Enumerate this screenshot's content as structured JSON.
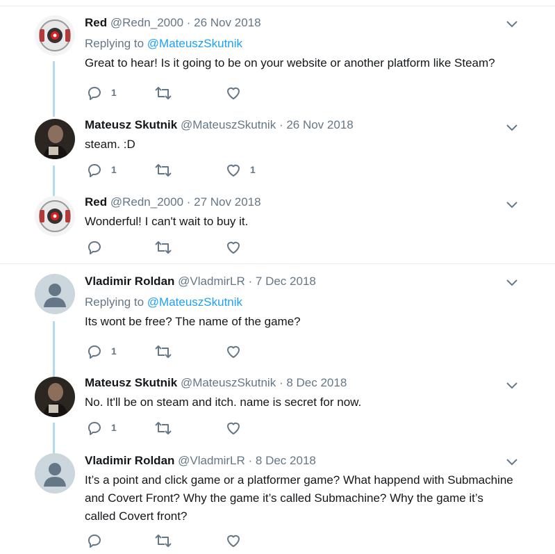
{
  "tweets": [
    {
      "name": "Red",
      "handle": "@Redn_2000",
      "date": "· 26 Nov 2018",
      "replying_prefix": "Replying to ",
      "replying_to": "@MateuszSkutnik",
      "text": "Great to hear! Is it going to be on your website or another platform like Steam?",
      "reply_count": "1",
      "retweet_count": "",
      "like_count": "",
      "avatar": "portal-core-avatar"
    },
    {
      "name": "Mateusz Skutnik",
      "handle": "@MateuszSkutnik",
      "date": "· 26 Nov 2018",
      "text": "steam. :D",
      "reply_count": "1",
      "retweet_count": "",
      "like_count": "1",
      "avatar": "photo-avatar"
    },
    {
      "name": "Red",
      "handle": "@Redn_2000",
      "date": "· 27 Nov 2018",
      "text": "Wonderful! I can't wait to buy it.",
      "reply_count": "",
      "retweet_count": "",
      "like_count": "",
      "avatar": "portal-core-avatar"
    },
    {
      "name": "Vladimir Roldan",
      "handle": "@VladmirLR",
      "date": "· 7 Dec 2018",
      "replying_prefix": "Replying to ",
      "replying_to": "@MateuszSkutnik",
      "text": "Its wont be free? The name of the game?",
      "reply_count": "1",
      "retweet_count": "",
      "like_count": "",
      "avatar": "default-avatar"
    },
    {
      "name": "Mateusz Skutnik",
      "handle": "@MateuszSkutnik",
      "date": "· 8 Dec 2018",
      "text": "No. It'll be on steam and itch. name is secret for now.",
      "reply_count": "1",
      "retweet_count": "",
      "like_count": "",
      "avatar": "photo-avatar"
    },
    {
      "name": "Vladimir Roldan",
      "handle": "@VladmirLR",
      "date": "· 8 Dec 2018",
      "text": "It’s a point and click game or a platformer game? What happend with Submachine and Covert Front? Why the game it’s called Submachine? Why the game it’s called Covert front?",
      "reply_count": "",
      "retweet_count": "",
      "like_count": "",
      "avatar": "default-avatar"
    }
  ],
  "colors": {
    "accent": "#1da1f2",
    "thread_line": "#b3dcf2",
    "secondary_text": "#657786",
    "divider": "#e6ecf0"
  }
}
